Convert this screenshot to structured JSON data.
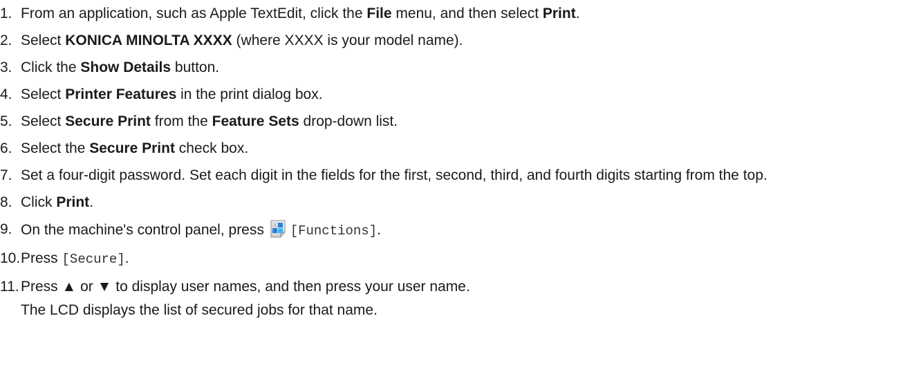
{
  "steps": [
    {
      "num": "1.",
      "parts": [
        "From an application, such as Apple TextEdit, click the ",
        "File",
        " menu, and then select ",
        "Print",
        "."
      ]
    },
    {
      "num": "2.",
      "parts": [
        "Select ",
        "KONICA MINOLTA XXXX",
        " (where XXXX is your model name)."
      ]
    },
    {
      "num": "3.",
      "parts": [
        "Click the ",
        "Show Details",
        " button."
      ]
    },
    {
      "num": "4.",
      "parts": [
        "Select ",
        "Printer Features",
        " in the print dialog box."
      ]
    },
    {
      "num": "5.",
      "parts": [
        "Select ",
        "Secure Print",
        " from the ",
        "Feature Sets",
        " drop-down list."
      ]
    },
    {
      "num": "6.",
      "parts": [
        "Select the ",
        "Secure Print",
        " check box."
      ]
    },
    {
      "num": "7.",
      "parts": [
        "Set a four-digit password. Set each digit in the fields for the first, second, third, and fourth digits starting from the top."
      ]
    },
    {
      "num": "8.",
      "parts": [
        "Click ",
        "Print",
        "."
      ]
    },
    {
      "num": "9.",
      "parts": [
        "On the machine's control panel, press ",
        "[Functions]",
        "."
      ]
    },
    {
      "num": "10.",
      "parts": [
        "Press ",
        "[Secure]",
        "."
      ]
    },
    {
      "num": "11.",
      "parts": [
        "Press ▲ or ▼ to display user names, and then press your user name."
      ],
      "note": "The LCD displays the list of secured jobs for that name."
    }
  ],
  "icons": {
    "functions": "functions-icon"
  }
}
